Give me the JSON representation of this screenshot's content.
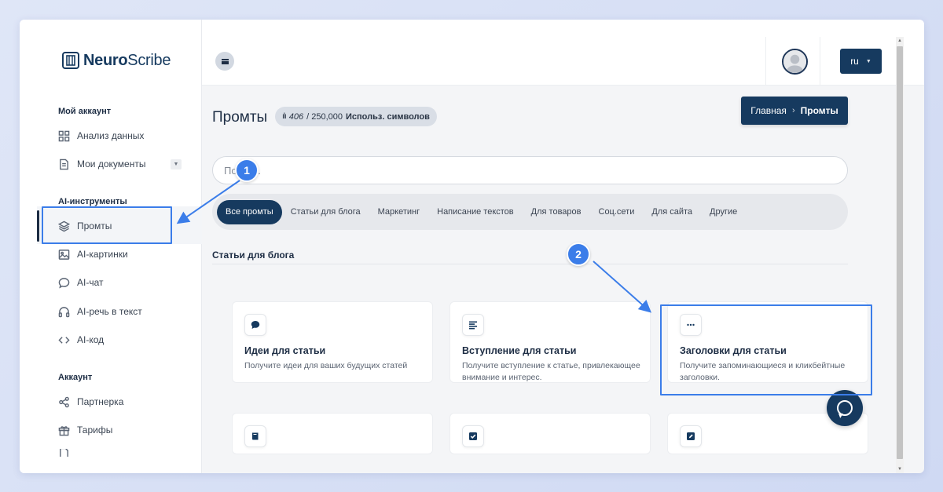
{
  "brand": {
    "name_bold": "Neuro",
    "name_light": "Scribe"
  },
  "sidebar": {
    "sections": [
      {
        "title": "Мой аккаунт"
      },
      {
        "title": "AI-инструменты"
      },
      {
        "title": "Аккаунт"
      }
    ],
    "items": [
      {
        "label": "Анализ данных",
        "icon": "grid-icon"
      },
      {
        "label": "Мои документы",
        "icon": "document-icon"
      },
      {
        "label": "Промты",
        "icon": "layers-icon"
      },
      {
        "label": "AI-картинки",
        "icon": "image-icon"
      },
      {
        "label": "AI-чат",
        "icon": "chat-bubble-icon"
      },
      {
        "label": "AI-речь в текст",
        "icon": "headphones-icon"
      },
      {
        "label": "AI-код",
        "icon": "code-icon"
      },
      {
        "label": "Партнерка",
        "icon": "share-icon"
      },
      {
        "label": "Тарифы",
        "icon": "gift-icon"
      }
    ]
  },
  "topbar": {
    "language": "ru"
  },
  "page": {
    "title": "Промты",
    "usage": {
      "used": "406",
      "total": "/ 250,000",
      "label": "Использ. символов"
    },
    "breadcrumb": {
      "home": "Главная",
      "sep": "›",
      "current": "Промты"
    },
    "search_placeholder": "Поиск..."
  },
  "tabs": [
    "Все промты",
    "Статьи для блога",
    "Маркетинг",
    "Написание текстов",
    "Для товаров",
    "Соц.сети",
    "Для сайта",
    "Другие"
  ],
  "section_title": "Статьи для блога",
  "cards": [
    {
      "title": "Идеи для статьи",
      "desc": "Получите идеи для ваших будущих статей",
      "icon": "speech-bubble-icon"
    },
    {
      "title": "Вступление для статьи",
      "desc": "Получите вступление к статье, привлекающее внимание и интерес.",
      "icon": "paragraph-icon"
    },
    {
      "title": "Заголовки для статьи",
      "desc": "Получите запоминающиеся и кликбейтные заголовки.",
      "icon": "ellipsis-icon"
    }
  ],
  "cards_row2": [
    {
      "icon": "book-icon"
    },
    {
      "icon": "checkbox-icon"
    },
    {
      "icon": "edit-icon"
    }
  ],
  "annotations": {
    "marker1": "1",
    "marker2": "2"
  },
  "colors": {
    "accent": "#163a5f",
    "highlight": "#3b7de9"
  }
}
